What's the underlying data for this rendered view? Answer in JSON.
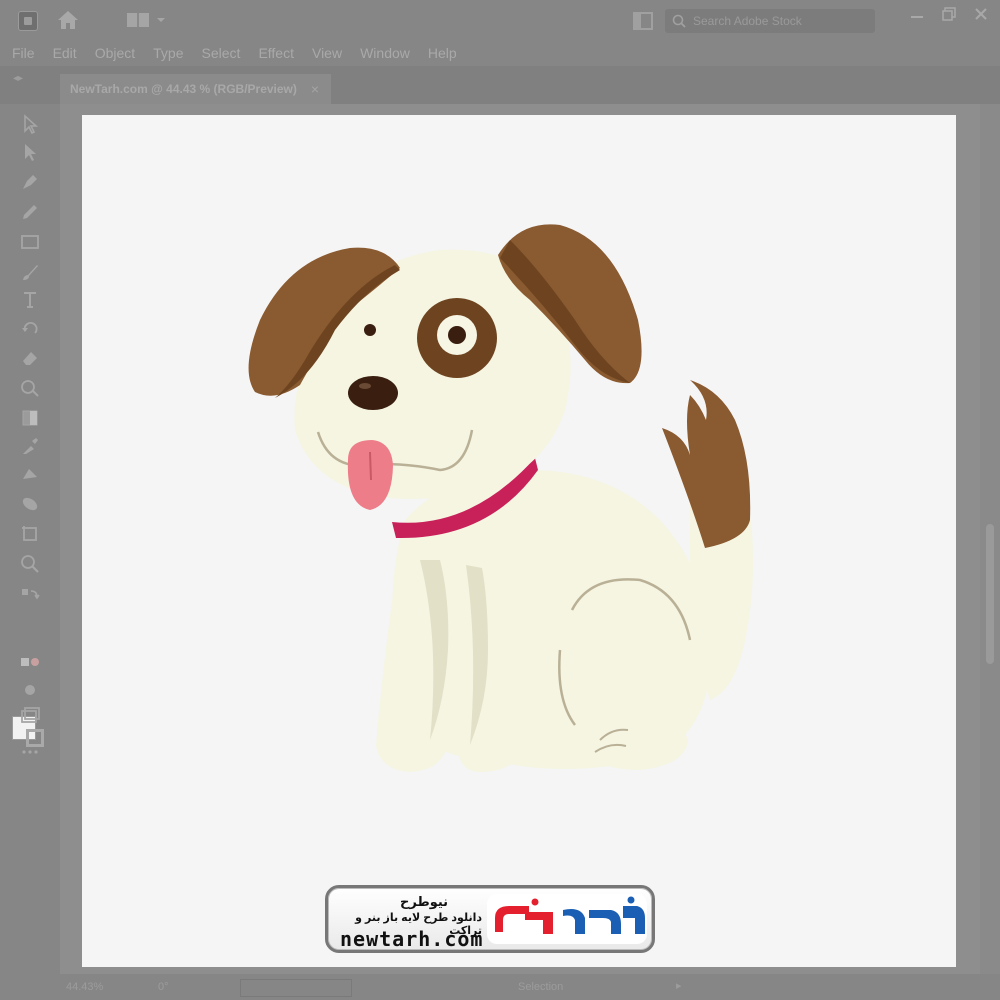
{
  "titlebar": {
    "search_placeholder": "Search Adobe Stock",
    "icons": [
      "illustrator-logo-icon",
      "home-icon",
      "workspace-switcher-icon",
      "arrange-documents-icon",
      "search-icon",
      "minimize-icon",
      "restore-icon",
      "close-icon"
    ]
  },
  "menu": {
    "items": [
      "File",
      "Edit",
      "Object",
      "Type",
      "Select",
      "Effect",
      "View",
      "Window",
      "Help"
    ]
  },
  "document_tab": {
    "label": "NewTarh.com @ 44.43 % (RGB/Preview)",
    "close": "×"
  },
  "toolbar": {
    "tools": [
      "selection-tool",
      "direct-selection-tool",
      "pen-tool",
      "pencil-tool",
      "rectangle-tool",
      "paintbrush-tool",
      "type-tool",
      "rotate-tool",
      "eraser-tool",
      "shape-builder-tool",
      "gradient-tool",
      "eyedropper-tool",
      "blend-tool",
      "symbol-sprayer-tool",
      "artboard-tool",
      "zoom-tool"
    ],
    "fill_color": "#f2f2f2"
  },
  "colors": {
    "dog_body": "#f5f5e2",
    "dog_shadow": "#e2e0c6",
    "ear_brown": "#8a5a30",
    "ear_dark": "#6e4420",
    "collar": "#c8215a",
    "tongue": "#ee7d8a",
    "nose": "#3a1f10"
  },
  "watermark": {
    "title": "نیوطرح",
    "subtitle": "دانلود طرح لایه باز بنر و تراکت",
    "domain": "newtarh.com",
    "logo_text": "نیوطرح"
  },
  "statusbar": {
    "zoom": "44.43%",
    "rotation": "0°",
    "mode": "Selection"
  }
}
